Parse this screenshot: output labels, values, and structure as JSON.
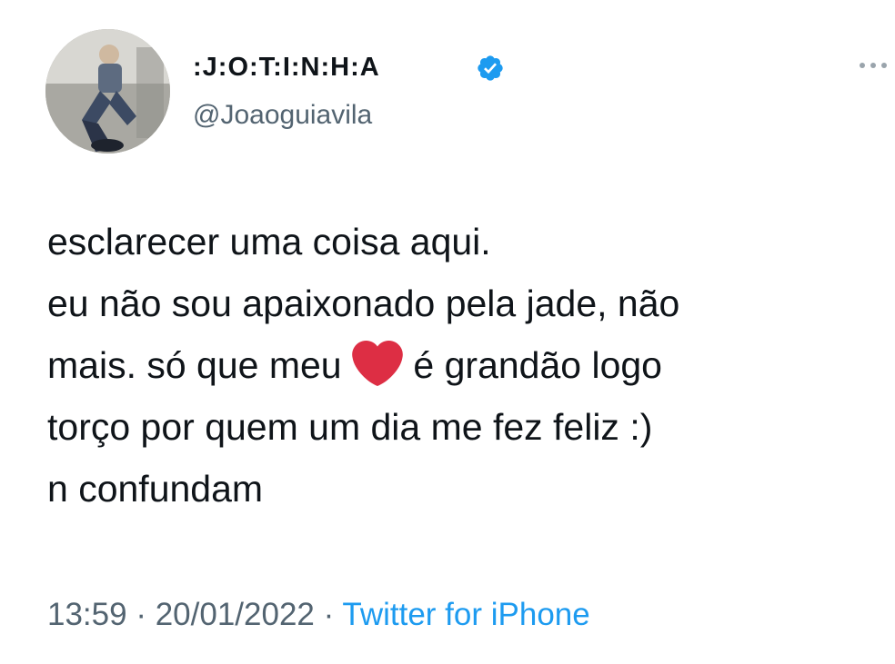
{
  "user": {
    "display_name": ":J:O:T:I:N:H:A",
    "handle": "@Joaoguiavila",
    "verified_icon": "verified-badge-icon",
    "avatar_icon": "profile-photo"
  },
  "tweet": {
    "lines": [
      "esclarecer uma coisa aqui.",
      "eu não sou apaixonado pela jade, não",
      "mais. só que meu",
      "é grandão logo",
      "torço por quem um dia me fez feliz :)",
      "n confundam"
    ],
    "emoji": "heart-emoji-icon"
  },
  "meta": {
    "time": "13:59",
    "separator": "·",
    "date": "20/01/2022",
    "source": "Twitter for iPhone"
  },
  "colors": {
    "text": "#0f1419",
    "secondary": "#536471",
    "link": "#1d9bf0",
    "verified": "#1d9bf0",
    "heart": "#dd2e44"
  },
  "more_icon": "more-dots-icon"
}
